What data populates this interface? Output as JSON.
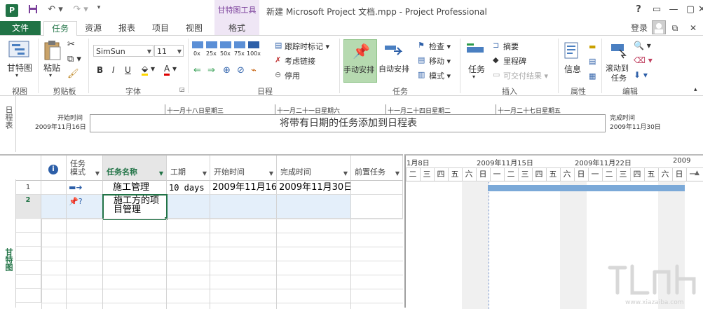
{
  "app": {
    "document_title": "新建 Microsoft Project 文档.mpp - Project Professional",
    "context_tab_group": "甘特图工具",
    "login": "登录",
    "help": "?"
  },
  "tabs": [
    "文件",
    "任务",
    "资源",
    "报表",
    "项目",
    "视图",
    "格式"
  ],
  "ribbon": {
    "view": {
      "gantt": "甘特图",
      "group": "视图"
    },
    "clipboard": {
      "paste": "粘贴",
      "group": "剪贴板"
    },
    "font": {
      "family": "SimSun",
      "size": "11",
      "bold": "B",
      "italic": "I",
      "underline": "U",
      "color_a": "A",
      "group": "字体"
    },
    "schedule": {
      "pcts": [
        "0x",
        "25x",
        "50x",
        "75x",
        "100x"
      ],
      "mark_track": "跟踪时标记",
      "respect_links": "考虑链接",
      "inactivate": "停用",
      "group": "日程"
    },
    "tasks": {
      "manual": "手动安排",
      "auto": "自动安排",
      "inspect": "检查",
      "move": "移动",
      "mode": "模式",
      "group": "任务"
    },
    "insert": {
      "task": "任务",
      "summary": "摘要",
      "milestone": "里程碑",
      "deliverable": "可交付结果",
      "group": "插入"
    },
    "properties": {
      "info": "信息",
      "group": "属性"
    },
    "editing": {
      "scroll_l1": "滚动到",
      "scroll_l2": "任务",
      "group": "编辑"
    }
  },
  "timeline": {
    "side_label": "日程表",
    "start_label": "开始时间",
    "start_date": "2009年11月16日",
    "finish_label": "完成时间",
    "finish_date": "2009年11月30日",
    "message": "将带有日期的任务添加到日程表",
    "ticks": [
      "十一月十八日星期三",
      "十一月二十一日星期六",
      "十一月二十四日星期二",
      "十一月二十七日星期五"
    ]
  },
  "grid": {
    "side_label": "甘特图",
    "headers": {
      "mode_l1": "任务",
      "mode_l2": "模式",
      "name": "任务名称",
      "duration": "工期",
      "start": "开始时间",
      "finish": "完成时间",
      "predecessors": "前置任务"
    },
    "rows": [
      {
        "num": "1",
        "name": "施工管理",
        "duration": "10 days",
        "start": "2009年11月16日",
        "finish": "2009年11月30日"
      },
      {
        "num": "2",
        "name_l1": "施工方的项",
        "name_l2": "目管理"
      }
    ]
  },
  "chart": {
    "weeks": [
      "1月8日",
      "2009年11月15日",
      "2009年11月22日",
      "2009"
    ],
    "days": [
      "二",
      "三",
      "四",
      "五",
      "六",
      "日",
      "一",
      "二",
      "三",
      "四",
      "五",
      "六",
      "日",
      "一",
      "二",
      "三",
      "四",
      "五",
      "六",
      "日",
      "一"
    ]
  },
  "colors": {
    "accent": "#217346",
    "context_tab": "#7a3f9a",
    "gantt_bar": "#7ba9d8",
    "manual_button": "#b6dab0"
  }
}
